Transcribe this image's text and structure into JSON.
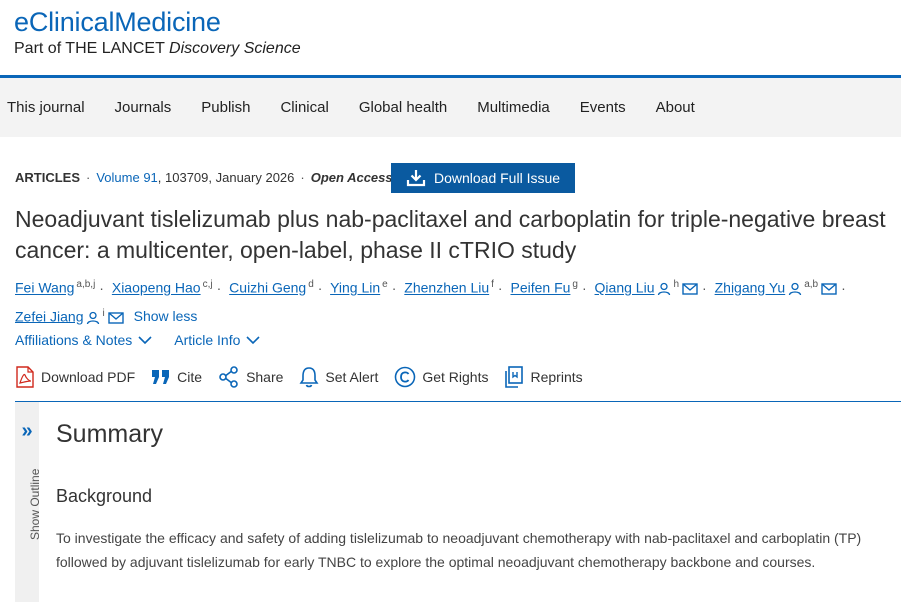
{
  "brand": {
    "title": "eClinicalMedicine",
    "subtitle_prefix": "Part of THE LANCET ",
    "subtitle_em": "Discovery Science"
  },
  "nav": [
    "This journal",
    "Journals",
    "Publish",
    "Clinical",
    "Global health",
    "Multimedia",
    "Events",
    "About"
  ],
  "meta": {
    "section": "ARTICLES",
    "volume": "Volume 91",
    "rest": ", 103709, January 2026",
    "open_access": "Open Access"
  },
  "download_issue": "Download Full Issue",
  "title": "Neoadjuvant tislelizumab plus nab-paclitaxel and carboplatin for triple-negative breast cancer: a multicenter, open-label, phase II cTRIO study",
  "authors": [
    {
      "name": "Fei Wang",
      "sup": "a,b,j"
    },
    {
      "name": "Xiaopeng Hao",
      "sup": "c,j"
    },
    {
      "name": "Cuizhi Geng",
      "sup": "d"
    },
    {
      "name": "Ying Lin",
      "sup": "e"
    },
    {
      "name": "Zhenzhen Liu",
      "sup": "f"
    },
    {
      "name": "Peifen Fu",
      "sup": "g"
    },
    {
      "name": "Qiang Liu",
      "sup": "h"
    },
    {
      "name": "Zhigang Yu",
      "sup": "a,b"
    },
    {
      "name": "Zefei Jiang",
      "sup": "i"
    }
  ],
  "show_less": "Show less",
  "disclosures": {
    "affiliations": "Affiliations & Notes",
    "article_info": "Article Info"
  },
  "toolbar": {
    "download_pdf": "Download PDF",
    "cite": "Cite",
    "share": "Share",
    "set_alert": "Set Alert",
    "get_rights": "Get Rights",
    "reprints": "Reprints"
  },
  "outline": {
    "label": "Show Outline"
  },
  "summary": {
    "heading": "Summary",
    "background_heading": "Background",
    "background_text": "To investigate the efficacy and safety of adding tislelizumab to neoadjuvant chemotherapy with nab-paclitaxel and carboplatin (TP) followed by adjuvant tislelizumab for early TNBC to explore the optimal neoadjuvant chemotherapy backbone and courses."
  },
  "colors": {
    "accent": "#0a66b8",
    "button": "#0a5aa0",
    "nav_bg": "#f3f3f3",
    "pdf_red": "#d0281c"
  }
}
